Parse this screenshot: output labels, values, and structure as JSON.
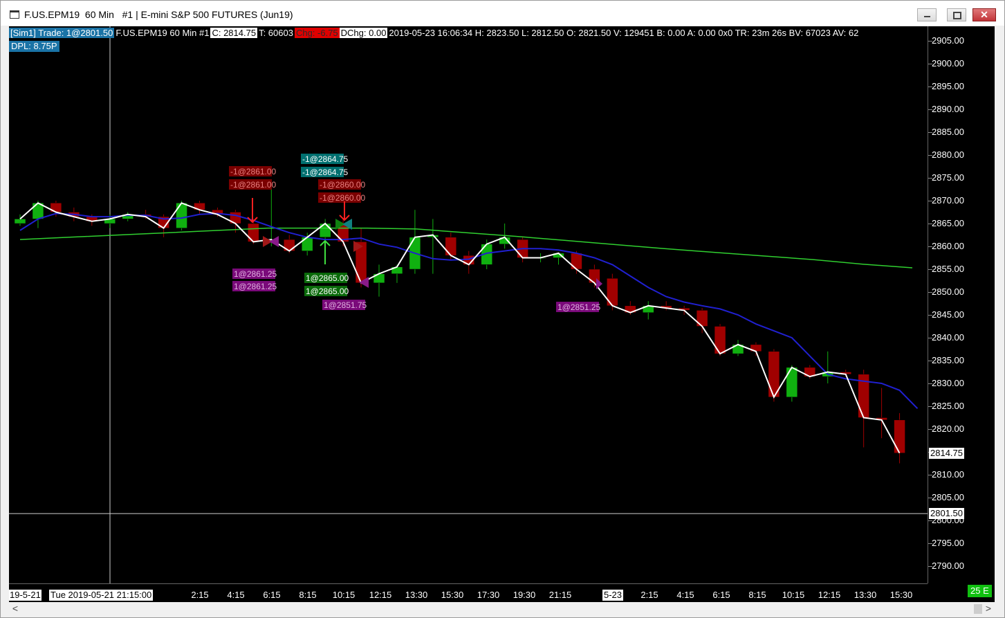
{
  "window": {
    "title": "F.US.EPM19  60 Min   #1 | E-mini S&P 500 FUTURES (Jun19)",
    "close_glyph": "✕"
  },
  "header": {
    "trade": "[Sim1]  Trade: 1@2801.50",
    "symbol": "F.US.EPM19  60 Min   #1",
    "close": "C: 2814.75",
    "ticks": "T: 60603",
    "change": "Chg: -6.75",
    "dchange": "DChg: 0.00",
    "stats": "2019-05-23 16:06:34 H: 2823.50  L: 2812.50  O: 2821.50  V: 129451  B: 0.00  A: 0.00  0x0  TR: 23m 26s  BV: 67023  AV: 62",
    "dpl": "DPL: 8.75P"
  },
  "price_axis": {
    "labels": [
      "2905.00",
      "2900.00",
      "2895.00",
      "2890.00",
      "2885.00",
      "2880.00",
      "2875.00",
      "2870.00",
      "2865.00",
      "2860.00",
      "2855.00",
      "2850.00",
      "2845.00",
      "2840.00",
      "2835.00",
      "2830.00",
      "2825.00",
      "2820.00",
      "2815.00",
      "2810.00",
      "2805.00",
      "2800.00",
      "2795.00",
      "2790.00"
    ],
    "last_price_tag": "2814.75",
    "position_tag": "2801.50"
  },
  "time_axis": {
    "left_date": "19-5-21",
    "cursor_date": "Tue 2019-05-21  21:15:00",
    "day_marker": "5-23",
    "labels": [
      "2:15",
      "4:15",
      "6:15",
      "8:15",
      "10:15",
      "12:15",
      "13:30",
      "15:30",
      "17:30",
      "19:30",
      "21:15",
      "2:15",
      "4:15",
      "6:15",
      "8:15",
      "10:15",
      "12:15",
      "13:30",
      "15:30"
    ],
    "bar_count": "25 E"
  },
  "scrollbar": {
    "left_glyph": "<",
    "right_glyph": ">"
  },
  "colors": {
    "bull": "#10b010",
    "bear": "#a00000",
    "fast_ma": "#ffffff",
    "mid_ma": "#2020d0",
    "slow_ma": "#30d030"
  },
  "chart_data": {
    "type": "candlestick",
    "ylim": [
      2787.5,
      2908.5
    ],
    "candles": [
      {
        "o": 2865,
        "h": 2867,
        "l": 2864.5,
        "c": 2866
      },
      {
        "o": 2866,
        "h": 2870,
        "l": 2864,
        "c": 2869.5
      },
      {
        "o": 2869.5,
        "h": 2870,
        "l": 2866.5,
        "c": 2867.5
      },
      {
        "o": 2867.5,
        "h": 2868.5,
        "l": 2865.5,
        "c": 2866.5
      },
      {
        "o": 2866.5,
        "h": 2867,
        "l": 2864.5,
        "c": 2865.5
      },
      {
        "o": 2865,
        "h": 2867,
        "l": 2864,
        "c": 2866
      },
      {
        "o": 2866,
        "h": 2867.5,
        "l": 2865.5,
        "c": 2867
      },
      {
        "o": 2867,
        "h": 2868,
        "l": 2866,
        "c": 2866.5
      },
      {
        "o": 2866.5,
        "h": 2867,
        "l": 2862,
        "c": 2864
      },
      {
        "o": 2864,
        "h": 2870,
        "l": 2863.5,
        "c": 2869.5
      },
      {
        "o": 2869.5,
        "h": 2870,
        "l": 2867,
        "c": 2868
      },
      {
        "o": 2868,
        "h": 2868.5,
        "l": 2866.5,
        "c": 2867
      },
      {
        "o": 2867.5,
        "h": 2868,
        "l": 2863,
        "c": 2865
      },
      {
        "o": 2865,
        "h": 2866,
        "l": 2860.5,
        "c": 2861
      },
      {
        "o": 2861,
        "h": 2873,
        "l": 2860,
        "c": 2861.5
      },
      {
        "o": 2861.5,
        "h": 2862.5,
        "l": 2858.5,
        "c": 2859
      },
      {
        "o": 2859,
        "h": 2863,
        "l": 2858,
        "c": 2862
      },
      {
        "o": 2862,
        "h": 2866,
        "l": 2861,
        "c": 2865
      },
      {
        "o": 2865,
        "h": 2866,
        "l": 2860,
        "c": 2861
      },
      {
        "o": 2861,
        "h": 2864,
        "l": 2851,
        "c": 2852
      },
      {
        "o": 2852,
        "h": 2856,
        "l": 2849,
        "c": 2854
      },
      {
        "o": 2854,
        "h": 2856,
        "l": 2852,
        "c": 2855.5
      },
      {
        "o": 2855,
        "h": 2868,
        "l": 2854,
        "c": 2862
      },
      {
        "o": 2862,
        "h": 2866,
        "l": 2854,
        "c": 2862.5
      },
      {
        "o": 2862,
        "h": 2863,
        "l": 2857,
        "c": 2858
      },
      {
        "o": 2858,
        "h": 2859,
        "l": 2854,
        "c": 2856
      },
      {
        "o": 2856,
        "h": 2861.5,
        "l": 2855,
        "c": 2860.5
      },
      {
        "o": 2860.5,
        "h": 2865,
        "l": 2859.5,
        "c": 2862
      },
      {
        "o": 2861.5,
        "h": 2862,
        "l": 2856.5,
        "c": 2857.5
      },
      {
        "o": 2857.5,
        "h": 2858.5,
        "l": 2856.5,
        "c": 2857.5
      },
      {
        "o": 2857.5,
        "h": 2858.5,
        "l": 2856,
        "c": 2858.5
      },
      {
        "o": 2858.5,
        "h": 2859,
        "l": 2854,
        "c": 2855
      },
      {
        "o": 2855,
        "h": 2856,
        "l": 2851,
        "c": 2852
      },
      {
        "o": 2853,
        "h": 2854,
        "l": 2846,
        "c": 2847
      },
      {
        "o": 2847,
        "h": 2848,
        "l": 2845,
        "c": 2845.5
      },
      {
        "o": 2845.5,
        "h": 2848,
        "l": 2844,
        "c": 2847
      },
      {
        "o": 2847,
        "h": 2848,
        "l": 2846,
        "c": 2846.5
      },
      {
        "o": 2846.5,
        "h": 2847,
        "l": 2845,
        "c": 2846
      },
      {
        "o": 2846,
        "h": 2846.5,
        "l": 2841,
        "c": 2842.5
      },
      {
        "o": 2842.5,
        "h": 2843,
        "l": 2836,
        "c": 2836.5
      },
      {
        "o": 2836.5,
        "h": 2839.5,
        "l": 2836,
        "c": 2838.5
      },
      {
        "o": 2838.5,
        "h": 2839,
        "l": 2836,
        "c": 2837
      },
      {
        "o": 2837,
        "h": 2837.5,
        "l": 2826,
        "c": 2827
      },
      {
        "o": 2827,
        "h": 2834,
        "l": 2826,
        "c": 2833.5
      },
      {
        "o": 2833.5,
        "h": 2834,
        "l": 2831,
        "c": 2831.5
      },
      {
        "o": 2831.5,
        "h": 2837,
        "l": 2830,
        "c": 2832.5
      },
      {
        "o": 2832.5,
        "h": 2833,
        "l": 2831.5,
        "c": 2832
      },
      {
        "o": 2832,
        "h": 2833,
        "l": 2816,
        "c": 2822.5
      },
      {
        "o": 2822.5,
        "h": 2829,
        "l": 2818,
        "c": 2822
      },
      {
        "o": 2822,
        "h": 2823.5,
        "l": 2812.5,
        "c": 2814.75
      }
    ],
    "slow_ma": [
      2861.5,
      2862,
      2862.5,
      2863,
      2863.5,
      2864,
      2864,
      2864,
      2863.8,
      2863,
      2862.2,
      2861.3,
      2860.4,
      2859.5,
      2858.7,
      2857.9,
      2857.1,
      2856.1,
      2855.3
    ],
    "mid_ma": [
      2863.5,
      2866,
      2867.2,
      2867,
      2866.5,
      2866.5,
      2866.8,
      2866.8,
      2866,
      2866.2,
      2867,
      2867.2,
      2866.8,
      2865.7,
      2864.3,
      2863,
      2862,
      2861.5,
      2861.5,
      2861.8,
      2860.5,
      2859.8,
      2858.5,
      2857.3,
      2857,
      2857.2,
      2858.5,
      2859,
      2859.5,
      2859.5,
      2859.2,
      2858.5,
      2857.5,
      2856,
      2853.5,
      2851,
      2849,
      2847.8,
      2847,
      2846.3,
      2845,
      2843,
      2841.5,
      2840,
      2836,
      2832,
      2831,
      2830.5,
      2830,
      2828.5,
      2824.5
    ],
    "orders": [
      {
        "text": "-1@2861.00",
        "type": "sell-red"
      },
      {
        "text": "-1@2861.00",
        "type": "sell-red"
      },
      {
        "text": "-1@2864.75",
        "type": "sell-teal"
      },
      {
        "text": "-1@2864.75",
        "type": "sell-teal"
      },
      {
        "text": "-1@2860.00",
        "type": "sell-red"
      },
      {
        "text": "-1@2860.00",
        "type": "sell-red"
      },
      {
        "text": "1@2861.25",
        "type": "buy-purple"
      },
      {
        "text": "1@2861.25",
        "type": "buy-purple"
      },
      {
        "text": "1@2865.00",
        "type": "buy-green"
      },
      {
        "text": "1@2865.00",
        "type": "buy-green"
      },
      {
        "text": "1@2851.75",
        "type": "buy-purple"
      },
      {
        "text": "1@2851.25",
        "type": "buy-purple"
      }
    ]
  }
}
